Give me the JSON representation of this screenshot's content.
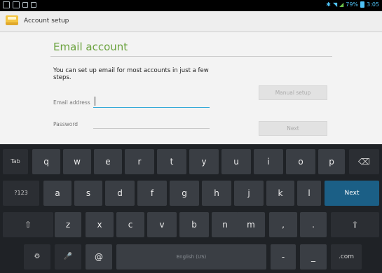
{
  "status_bar": {
    "left_icons": [
      "notification-icon",
      "screenshot-icon",
      "usb-icon",
      "android-icon"
    ],
    "right_icons": [
      "bluetooth-icon",
      "wifi-icon",
      "signal-icon",
      "battery-icon"
    ],
    "battery_text": "79%",
    "time": "3:05"
  },
  "action_bar": {
    "icon": "email-app-icon",
    "title": "Account setup"
  },
  "main": {
    "heading": "Email account",
    "intro": "You can set up email for most accounts in just a few steps.",
    "email_label": "Email address",
    "email_value": "",
    "password_label": "Password",
    "password_value": "",
    "manual_setup_label": "Manual setup",
    "next_label": "Next"
  },
  "keyboard": {
    "row1": [
      "Tab",
      "q",
      "w",
      "e",
      "r",
      "t",
      "y",
      "u",
      "i",
      "o",
      "p",
      "⌫"
    ],
    "row2": [
      "?123",
      "a",
      "s",
      "d",
      "f",
      "g",
      "h",
      "j",
      "k",
      "l",
      "Next"
    ],
    "row3": [
      "⇧",
      "z",
      "x",
      "c",
      "v",
      "b",
      "n",
      "m",
      ",",
      ".",
      "⇧"
    ],
    "row4": [
      "⚙",
      "🎤",
      "@",
      "English (US)",
      "-",
      "_",
      ".com"
    ]
  }
}
